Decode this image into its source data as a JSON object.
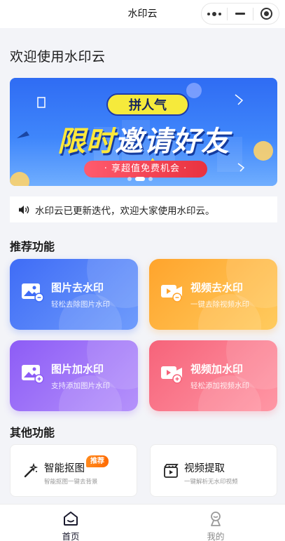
{
  "nav": {
    "title": "水印云"
  },
  "welcome": "欢迎使用水印云",
  "banner": {
    "tag": "拼人气",
    "title_part1": "限时",
    "title_part2": "邀请好友",
    "subtitle": "· 享超值免费机会 ·"
  },
  "notice": {
    "text": "水印云已更新迭代，欢迎大家使用水印云。"
  },
  "recommended": {
    "title": "推荐功能",
    "cards": [
      {
        "title": "图片去水印",
        "subtitle": "轻松去除图片水印",
        "color": "#3f6cf6"
      },
      {
        "title": "视频去水印",
        "subtitle": "一键去除视频水印",
        "color": "#ffa42c"
      },
      {
        "title": "图片加水印",
        "subtitle": "支持添加图片水印",
        "color": "#8d5cf6"
      },
      {
        "title": "视频加水印",
        "subtitle": "轻松添加视频水印",
        "color": "#f6637a"
      }
    ]
  },
  "other": {
    "title": "其他功能",
    "cards": [
      {
        "title": "智能抠图",
        "subtitle": "智能抠图一键去背景",
        "badge": "推荐",
        "icon": "magic-wand-icon"
      },
      {
        "title": "视频提取",
        "subtitle": "一键解析无水印视频",
        "icon": "clapperboard-icon"
      }
    ]
  },
  "tabbar": {
    "items": [
      {
        "label": "首页",
        "icon": "home-icon",
        "active": true
      },
      {
        "label": "我的",
        "icon": "profile-icon",
        "active": false
      }
    ]
  }
}
